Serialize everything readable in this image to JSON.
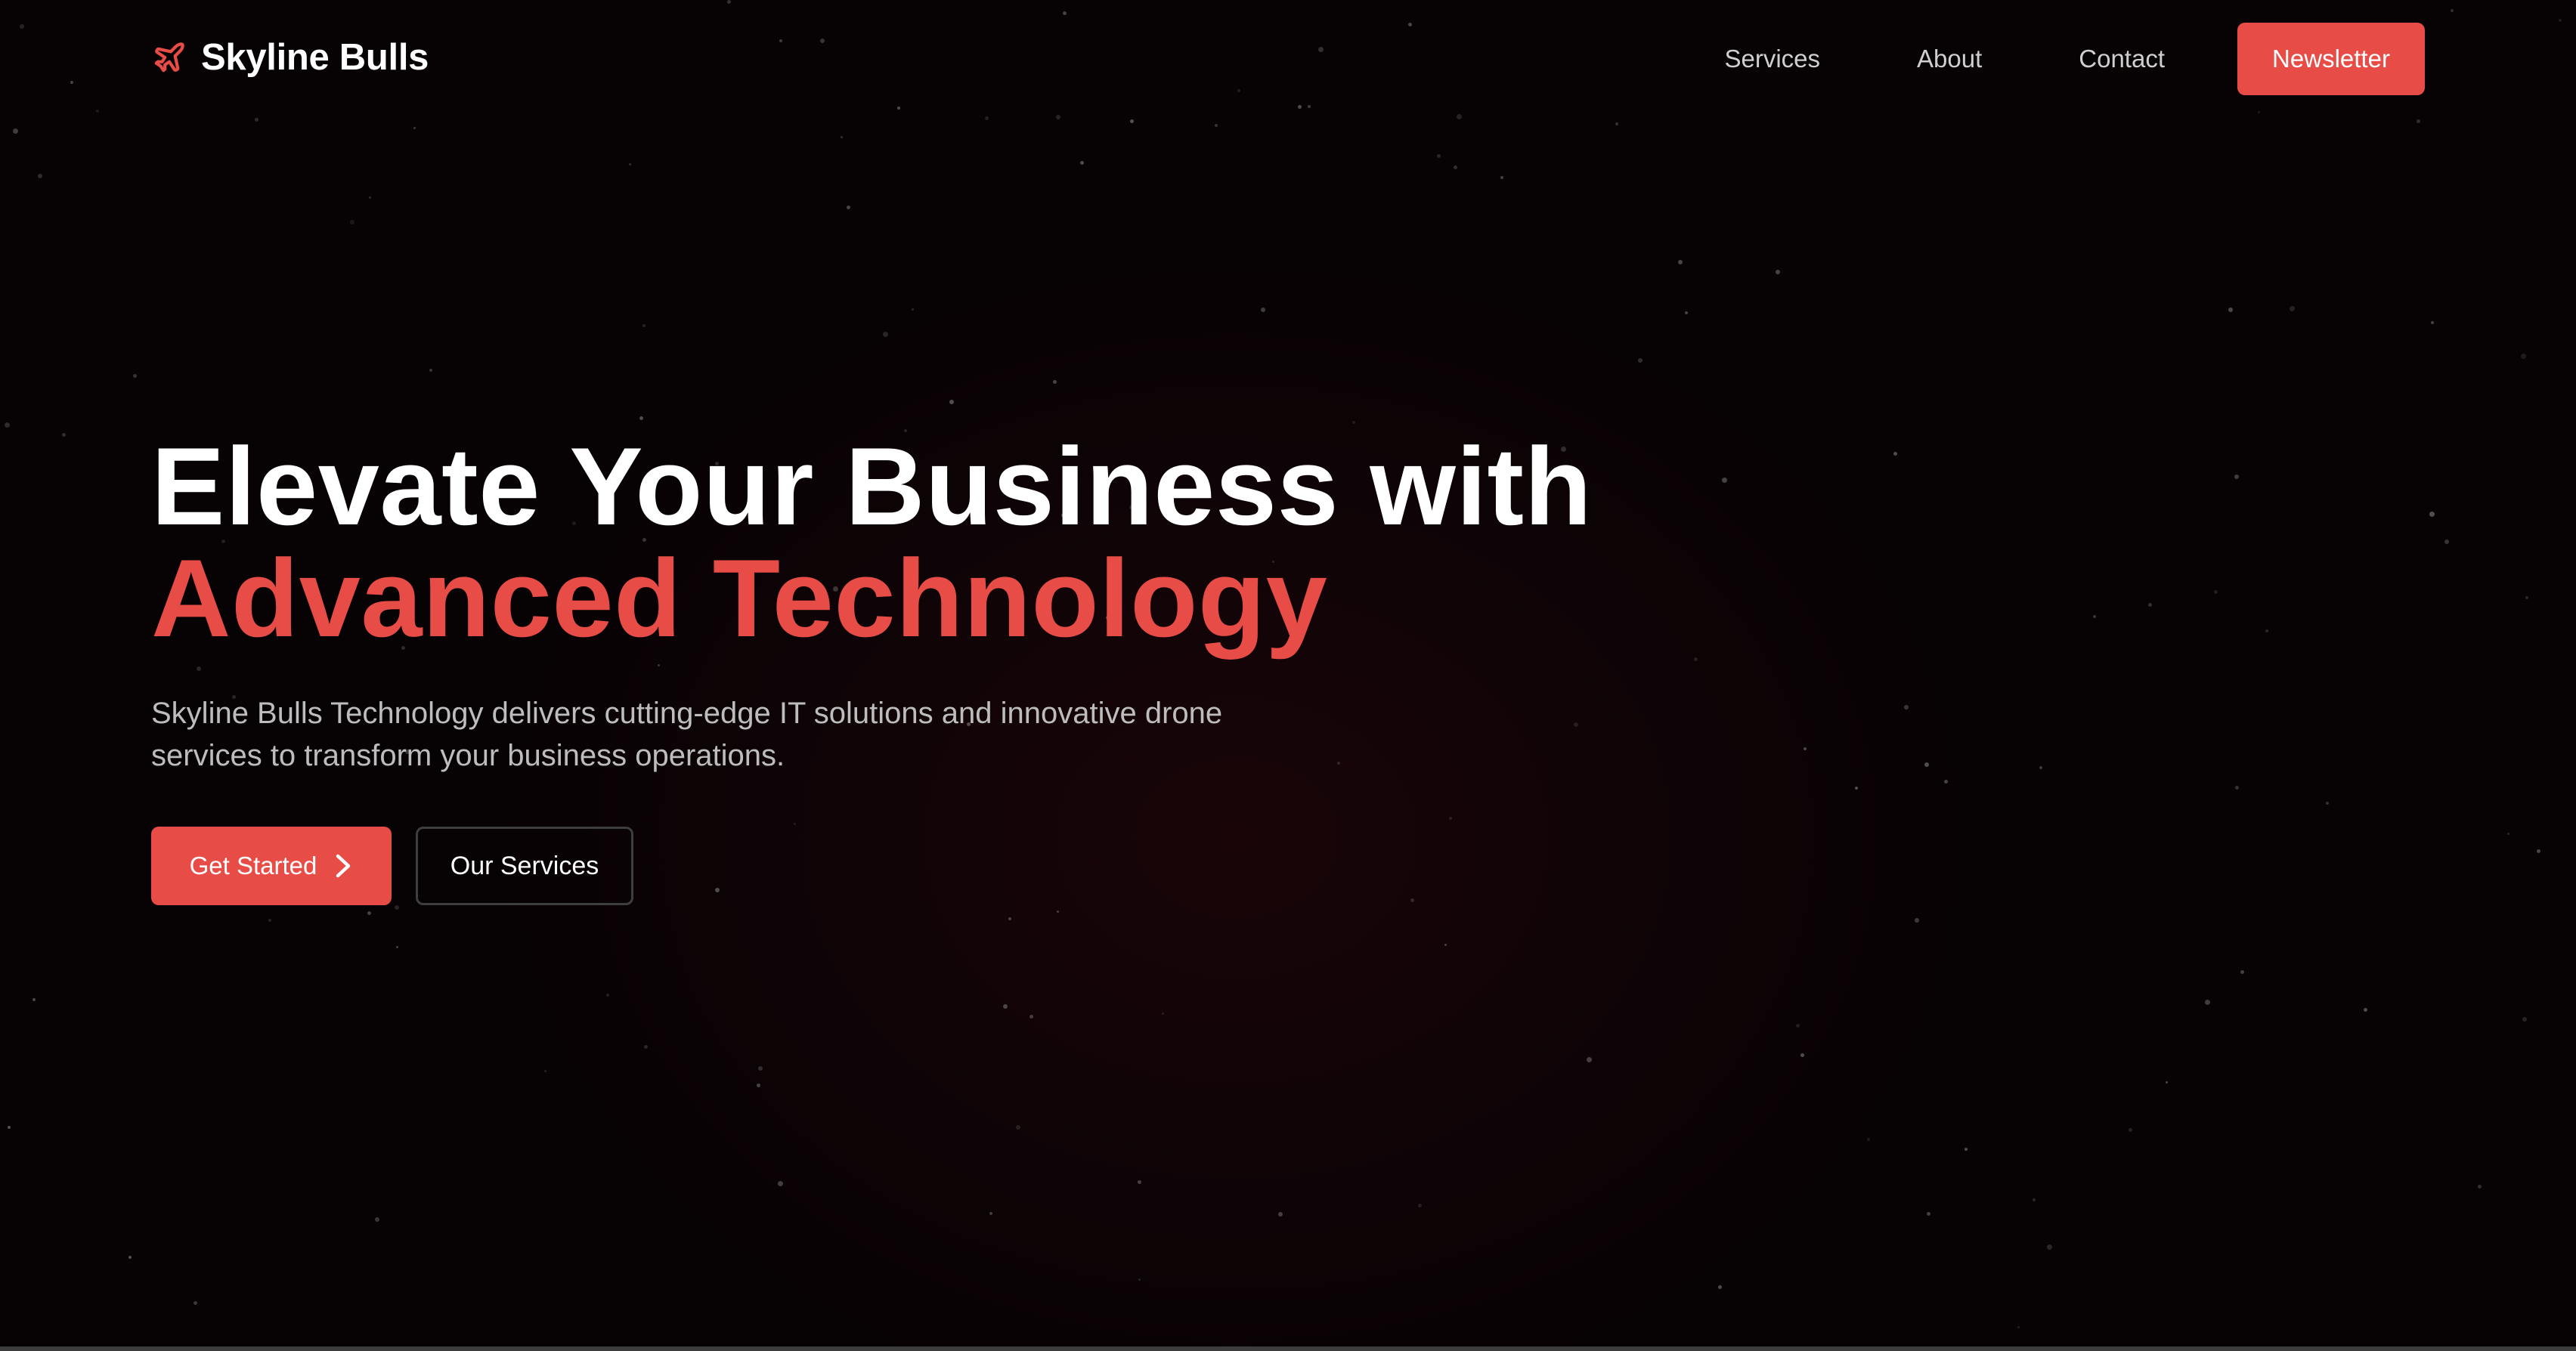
{
  "brand": {
    "name": "Skyline Bulls",
    "icon": "plane-icon",
    "accent_color": "#e84c47"
  },
  "nav": {
    "items": [
      {
        "label": "Services"
      },
      {
        "label": "About"
      },
      {
        "label": "Contact"
      }
    ],
    "cta_label": "Newsletter"
  },
  "hero": {
    "title_line1": "Elevate Your Business with",
    "title_line2": "Advanced Technology",
    "subtitle": "Skyline Bulls Technology delivers cutting-edge IT solutions and innovative drone services to transform your business operations.",
    "primary_cta": "Get Started",
    "primary_cta_icon": "chevron-right-icon",
    "secondary_cta": "Our Services"
  },
  "colors": {
    "background": "#070204",
    "text_primary": "#ffffff",
    "text_muted": "#bdbdbd",
    "button_border": "#3e3e3e"
  }
}
